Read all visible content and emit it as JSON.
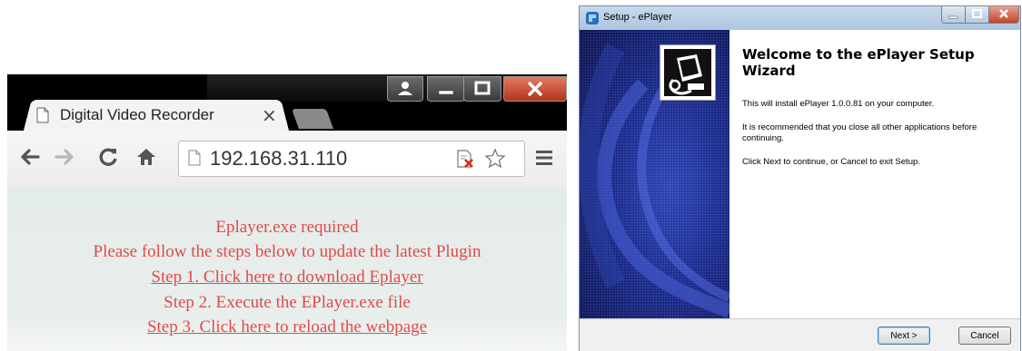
{
  "browser": {
    "tab": {
      "title": "Digital Video Recorder",
      "close": "×"
    },
    "address": {
      "value": "192.168.31.110"
    },
    "content": {
      "line1": "Eplayer.exe required",
      "line2": "Please follow the steps below to update the latest Plugin",
      "step1": "Step 1. Click here to download Eplayer",
      "step2": "Step 2. Execute the EPlayer.exe file",
      "step3": "Step 3. Click here to reload the webpage",
      "color": "#e04a4a"
    },
    "icons": [
      "page-icon",
      "user-icon",
      "minimize-icon",
      "maximize-icon",
      "close-icon",
      "back-arrow-icon",
      "forward-arrow-icon",
      "reload-icon",
      "home-icon",
      "blocked-plugin-icon",
      "star-icon",
      "menu-icon"
    ]
  },
  "wizard": {
    "title": "Setup - ePlayer",
    "heading": "Welcome to the ePlayer Setup Wizard",
    "paragraphs": [
      "This will install ePlayer 1.0.0.81 on your computer.",
      "It is recommended that you close all other applications before continuing.",
      "Click Next to continue, or Cancel to exit Setup."
    ],
    "buttons": {
      "next": "Next >",
      "cancel": "Cancel"
    },
    "banner_color": "#1a2a8c"
  }
}
